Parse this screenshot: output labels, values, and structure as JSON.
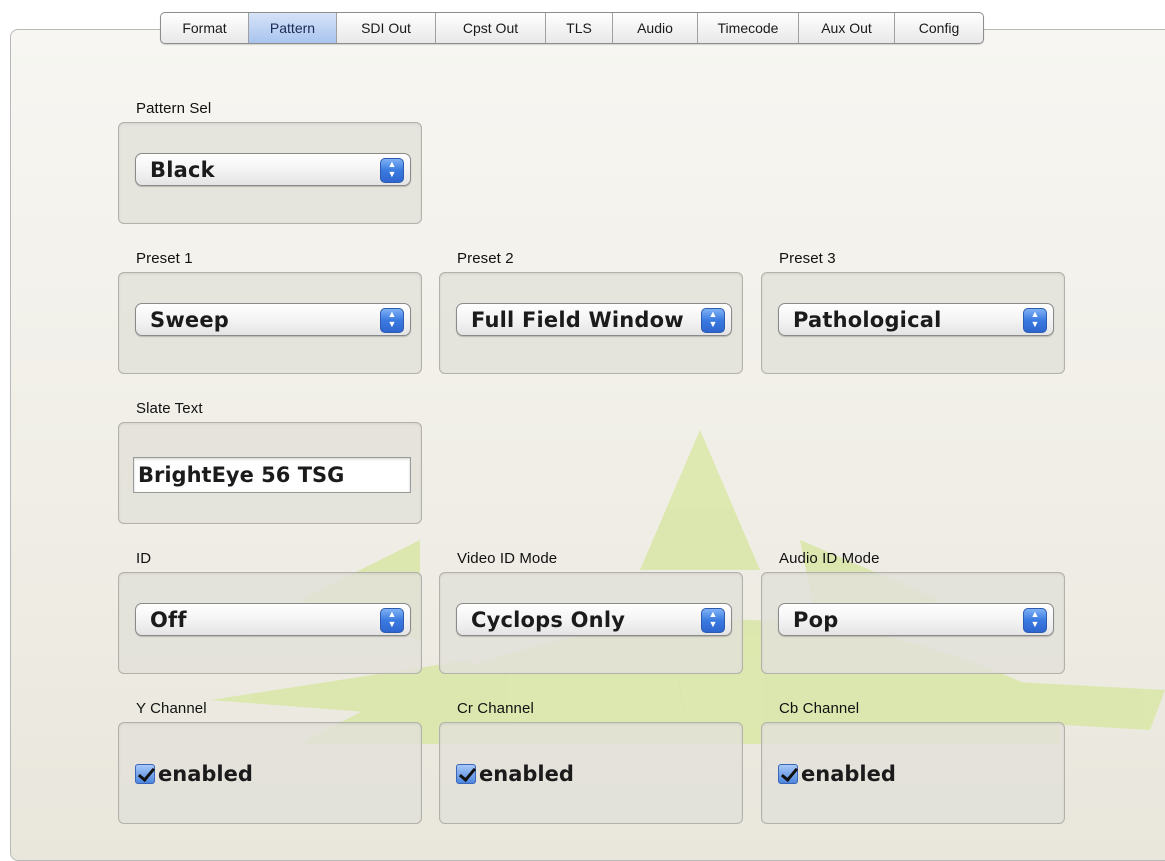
{
  "tabs": [
    {
      "label": "Format",
      "active": false
    },
    {
      "label": "Pattern",
      "active": true
    },
    {
      "label": "SDI Out",
      "active": false
    },
    {
      "label": "Cpst Out",
      "active": false
    },
    {
      "label": "TLS",
      "active": false
    },
    {
      "label": "Audio",
      "active": false
    },
    {
      "label": "Timecode",
      "active": false
    },
    {
      "label": "Aux Out",
      "active": false
    },
    {
      "label": "Config",
      "active": false
    }
  ],
  "pattern_sel": {
    "label": "Pattern Sel",
    "value": "Black"
  },
  "preset1": {
    "label": "Preset 1",
    "value": "Sweep"
  },
  "preset2": {
    "label": "Preset 2",
    "value": "Full Field Window"
  },
  "preset3": {
    "label": "Preset 3",
    "value": "Pathological"
  },
  "slate_text": {
    "label": "Slate Text",
    "value": "BrightEye 56 TSG"
  },
  "id": {
    "label": "ID",
    "value": "Off"
  },
  "video_id_mode": {
    "label": "Video ID Mode",
    "value": "Cyclops Only"
  },
  "audio_id_mode": {
    "label": "Audio ID Mode",
    "value": "Pop"
  },
  "y_channel": {
    "label": "Y Channel",
    "checkbox_label": "enabled",
    "checked": true
  },
  "cr_channel": {
    "label": "Cr Channel",
    "checkbox_label": "enabled",
    "checked": true
  },
  "cb_channel": {
    "label": "Cb Channel",
    "checkbox_label": "enabled",
    "checked": true
  },
  "colors": {
    "accent": "#3a7ae0",
    "tab_active": "#a9c4ee",
    "watermark_green": "#d8e6a0",
    "watermark_gray": "#8f8f8f"
  }
}
